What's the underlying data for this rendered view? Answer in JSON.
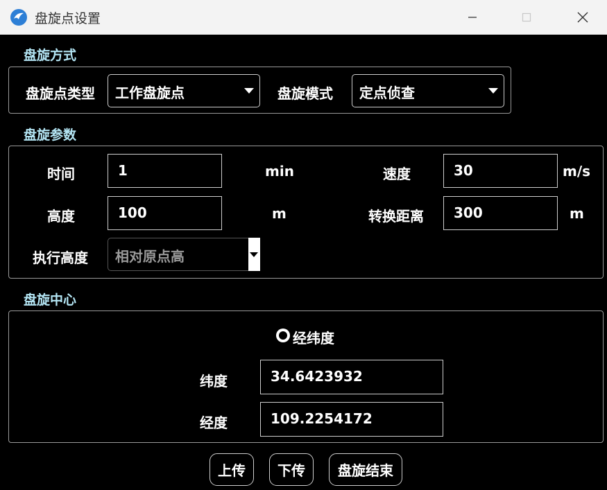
{
  "window": {
    "title": "盘旋点设置",
    "minimize_icon": "minimize-icon",
    "maximize_icon": "maximize-icon",
    "close_icon": "close-icon"
  },
  "hover_mode": {
    "section_title": "盘旋方式",
    "type_label": "盘旋点类型",
    "type_value": "工作盘旋点",
    "mode_label": "盘旋模式",
    "mode_value": "定点侦查"
  },
  "params": {
    "section_title": "盘旋参数",
    "time_label": "时间",
    "time_value": "1",
    "time_unit": "min",
    "speed_label": "速度",
    "speed_value": "30",
    "speed_unit": "m/s",
    "height_label": "高度",
    "height_value": "100",
    "height_unit": "m",
    "switch_label": "转换距离",
    "switch_value": "300",
    "switch_unit": "m",
    "exec_label": "执行高度",
    "exec_value": "相对原点高"
  },
  "center": {
    "section_title": "盘旋中心",
    "radio_label": "经纬度",
    "lat_label": "纬度",
    "lat_value": "34.6423932",
    "lon_label": "经度",
    "lon_value": "109.2254172"
  },
  "buttons": {
    "upload": "上传",
    "download": "下传",
    "end": "盘旋结束"
  },
  "colors": {
    "background": "#000000",
    "section_title": "#b4e6f5",
    "titlebar": "#f3f3f3"
  }
}
